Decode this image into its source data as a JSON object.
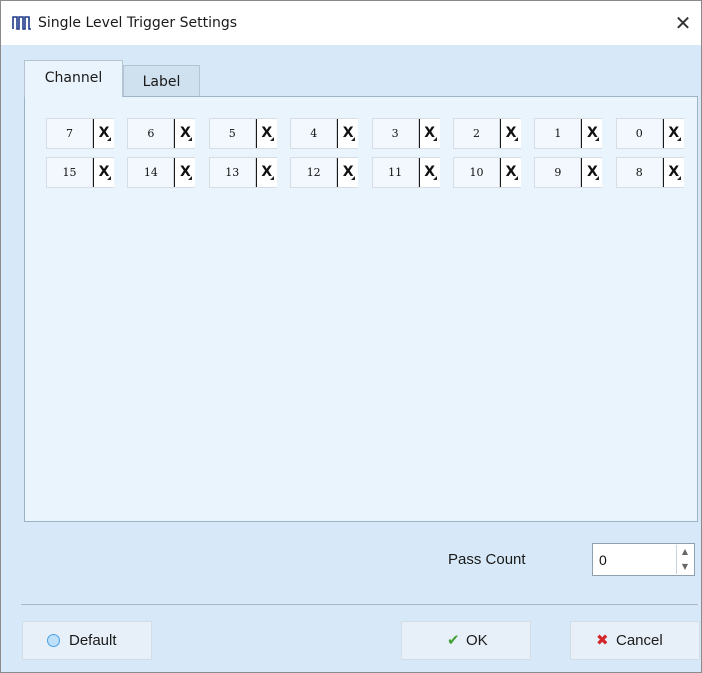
{
  "window": {
    "title": "Single Level Trigger Settings",
    "close_symbol": "✕",
    "app_icon": "pulse-waveform-icon"
  },
  "tabs": [
    {
      "label": "Channel",
      "active": true
    },
    {
      "label": "Label",
      "active": false
    }
  ],
  "channels": {
    "row1": [
      "7",
      "6",
      "5",
      "4",
      "3",
      "2",
      "1",
      "0"
    ],
    "row2": [
      "15",
      "14",
      "13",
      "12",
      "11",
      "10",
      "9",
      "8"
    ],
    "state_label": "X"
  },
  "pass_count": {
    "label": "Pass Count",
    "value": "0",
    "up_symbol": "▲",
    "down_symbol": "▼"
  },
  "buttons": {
    "default_label": "Default",
    "ok_label": "OK",
    "cancel_label": "Cancel",
    "ok_symbol": "✔",
    "cancel_symbol": "✖"
  },
  "colors": {
    "background": "#d7e9f8",
    "panel": "#eaf4fd",
    "ok_green": "#45a035",
    "cancel_red": "#d3262b",
    "radio_blue": "#4aa0e6"
  }
}
